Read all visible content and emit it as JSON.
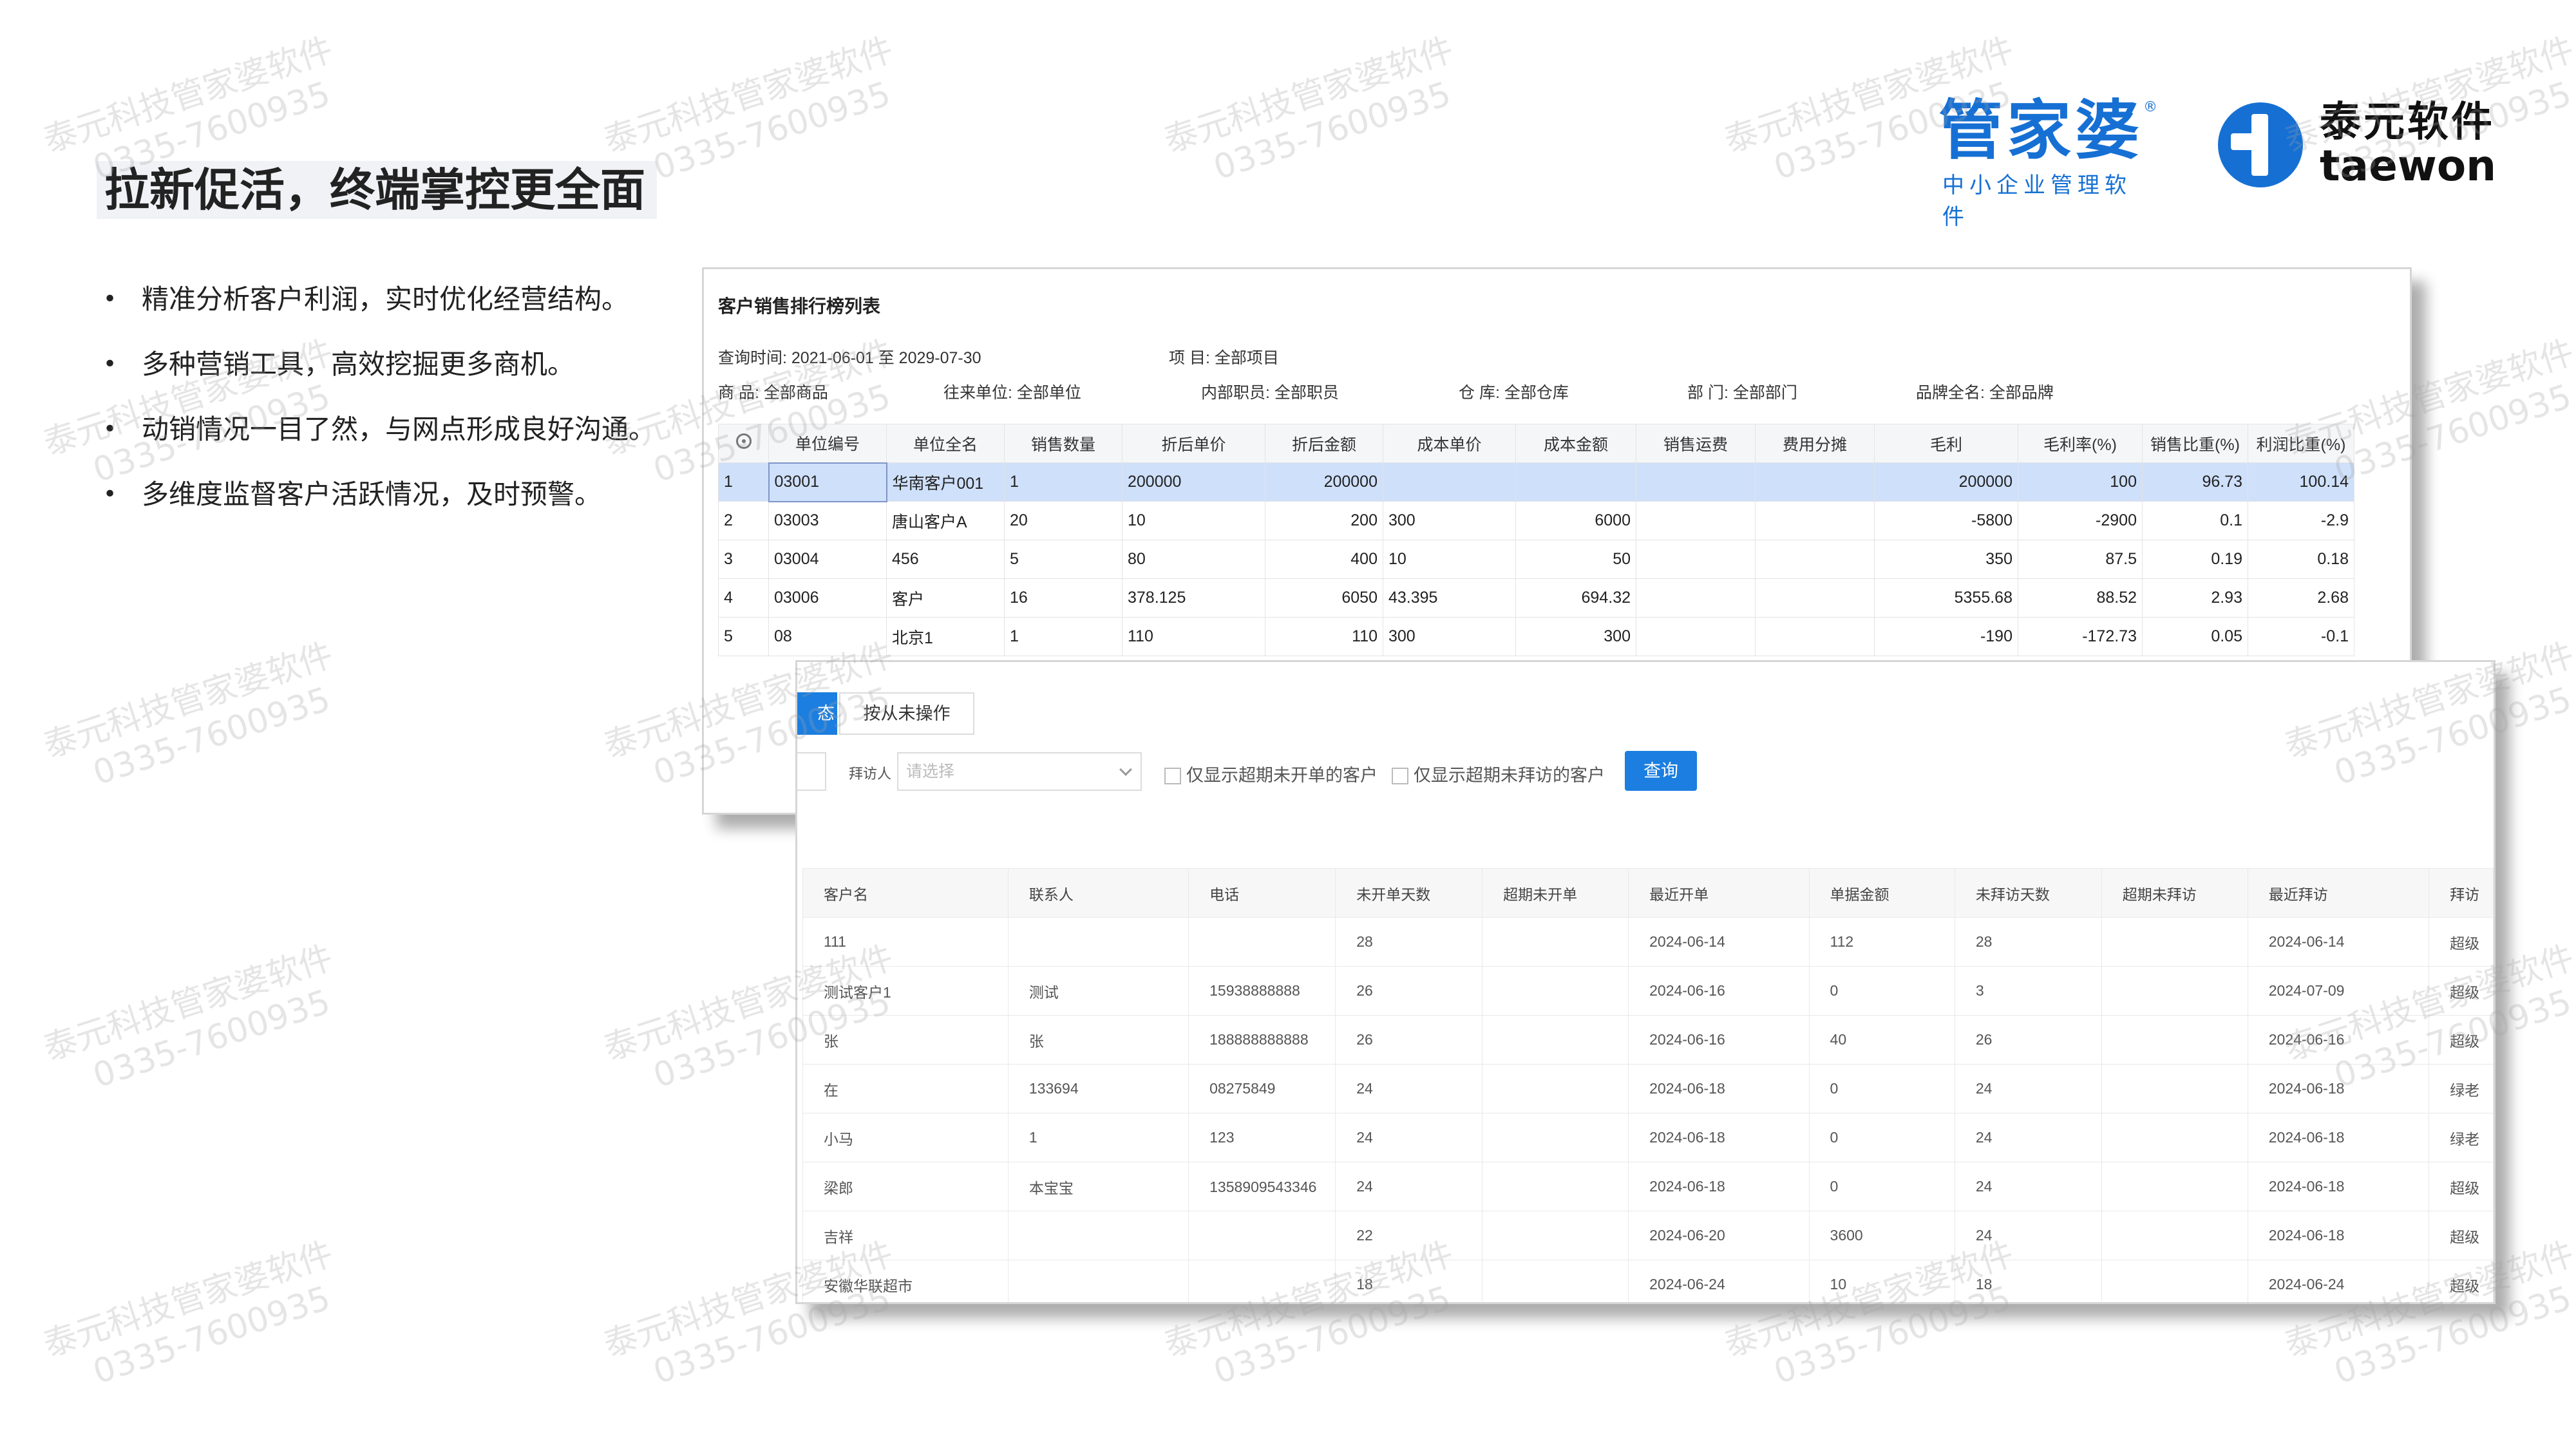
{
  "slide": {
    "title": "拉新促活，终端掌控更全面",
    "bullets": [
      "精准分析客户利润，实时优化经营结构。",
      "多种营销工具，高效挖掘更多商机。",
      "动销情况一目了然，与网点形成良好沟通。",
      "多维度监督客户活跃情况，及时预警。"
    ]
  },
  "brands": {
    "gjp_name": "管家婆",
    "gjp_reg": "®",
    "gjp_sub": "中小企业管理软件",
    "taewon_cn": "泰元软件",
    "taewon_en": "taewon",
    "taewon_color": "#1670d4",
    "gjp_color": "#1670d4"
  },
  "watermark": {
    "line1": "泰元科技管家婆软件",
    "line2": "0335-7600935"
  },
  "report": {
    "title": "客户销售排行榜列表",
    "query_time": "查询时间: 2021-06-01 至 2029-07-30",
    "project": "项 目: 全部项目",
    "product": "商 品: 全部商品",
    "unit": "往来单位: 全部单位",
    "staff": "内部职员: 全部职员",
    "warehouse": "仓 库: 全部仓库",
    "dept": "部 门: 全部部门",
    "brand": "品牌全名: 全部品牌",
    "columns": [
      "",
      "单位编号",
      "单位全名",
      "销售数量",
      "折后单价",
      "折后金额",
      "成本单价",
      "成本金额",
      "销售运费",
      "费用分摊",
      "毛利",
      "毛利率(%)",
      "销售比重(%)",
      "利润比重(%)"
    ],
    "rows": [
      [
        "1",
        "03001",
        "华南客户001",
        "1",
        "200000",
        "200000",
        "",
        "",
        "",
        "",
        "200000",
        "100",
        "96.73",
        "100.14"
      ],
      [
        "2",
        "03003",
        "唐山客户A",
        "20",
        "10",
        "200",
        "300",
        "6000",
        "",
        "",
        "-5800",
        "-2900",
        "0.1",
        "-2.9"
      ],
      [
        "3",
        "03004",
        "456",
        "5",
        "80",
        "400",
        "10",
        "50",
        "",
        "",
        "350",
        "87.5",
        "0.19",
        "0.18"
      ],
      [
        "4",
        "03006",
        "客户",
        "16",
        "378.125",
        "6050",
        "43.395",
        "694.32",
        "",
        "",
        "5355.68",
        "88.52",
        "2.93",
        "2.68"
      ],
      [
        "5",
        "08",
        "北京1",
        "1",
        "110",
        "110",
        "300",
        "300",
        "",
        "",
        "-190",
        "-172.73",
        "0.05",
        "-0.1"
      ]
    ],
    "selected_row_color": "#cfe0fb"
  },
  "followup": {
    "active_tab_label": "态",
    "tab_label": "按从未操作",
    "visitor_label": "拜访人",
    "visitor_placeholder": "请选择",
    "check1": "仅显示超期未开单的客户",
    "check2": "仅显示超期未拜访的客户",
    "query_button": "查询",
    "accent_color": "#1b7ee0",
    "columns": [
      "客户名",
      "联系人",
      "电话",
      "未开单天数",
      "超期未开单",
      "最近开单",
      "单据金额",
      "未拜访天数",
      "超期未拜访",
      "最近拜访",
      "拜访"
    ],
    "rows": [
      [
        "111",
        "",
        "",
        "28",
        "",
        "2024-06-14",
        "112",
        "28",
        "",
        "2024-06-14",
        "超级"
      ],
      [
        "测试客户1",
        "测试",
        "15938888888",
        "26",
        "",
        "2024-06-16",
        "0",
        "3",
        "",
        "2024-07-09",
        "超级"
      ],
      [
        "张",
        "张",
        "188888888888",
        "26",
        "",
        "2024-06-16",
        "40",
        "26",
        "",
        "2024-06-16",
        "超级"
      ],
      [
        "在",
        "133694",
        "08275849",
        "24",
        "",
        "2024-06-18",
        "0",
        "24",
        "",
        "2024-06-18",
        "绿老"
      ],
      [
        "小马",
        "1",
        "123",
        "24",
        "",
        "2024-06-18",
        "0",
        "24",
        "",
        "2024-06-18",
        "绿老"
      ],
      [
        "梁郎",
        "本宝宝",
        "1358909543346",
        "24",
        "",
        "2024-06-18",
        "0",
        "24",
        "",
        "2024-06-18",
        "超级"
      ],
      [
        "吉祥",
        "",
        "",
        "22",
        "",
        "2024-06-20",
        "3600",
        "24",
        "",
        "2024-06-18",
        "超级"
      ],
      [
        "安徽华联超市",
        "",
        "",
        "18",
        "",
        "2024-06-24",
        "10",
        "18",
        "",
        "2024-06-24",
        "超级"
      ]
    ]
  }
}
